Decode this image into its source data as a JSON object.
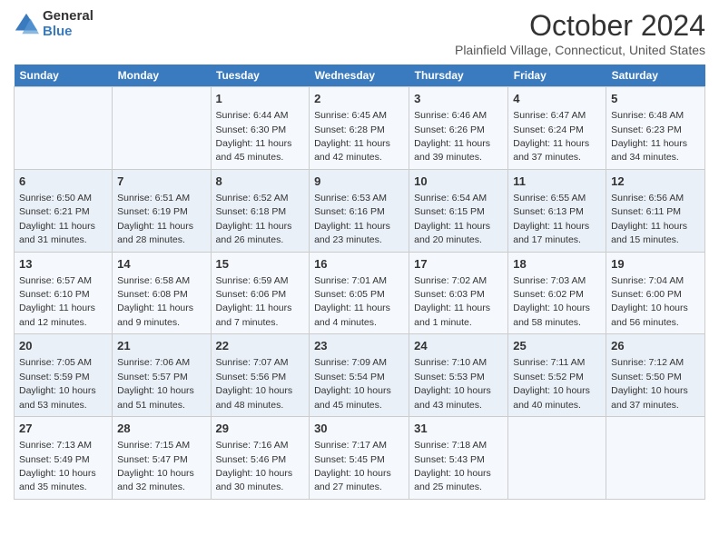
{
  "logo": {
    "general": "General",
    "blue": "Blue"
  },
  "header": {
    "month": "October 2024",
    "location": "Plainfield Village, Connecticut, United States"
  },
  "days_of_week": [
    "Sunday",
    "Monday",
    "Tuesday",
    "Wednesday",
    "Thursday",
    "Friday",
    "Saturday"
  ],
  "weeks": [
    [
      {
        "day": "",
        "info": ""
      },
      {
        "day": "",
        "info": ""
      },
      {
        "day": "1",
        "info": "Sunrise: 6:44 AM\nSunset: 6:30 PM\nDaylight: 11 hours and 45 minutes."
      },
      {
        "day": "2",
        "info": "Sunrise: 6:45 AM\nSunset: 6:28 PM\nDaylight: 11 hours and 42 minutes."
      },
      {
        "day": "3",
        "info": "Sunrise: 6:46 AM\nSunset: 6:26 PM\nDaylight: 11 hours and 39 minutes."
      },
      {
        "day": "4",
        "info": "Sunrise: 6:47 AM\nSunset: 6:24 PM\nDaylight: 11 hours and 37 minutes."
      },
      {
        "day": "5",
        "info": "Sunrise: 6:48 AM\nSunset: 6:23 PM\nDaylight: 11 hours and 34 minutes."
      }
    ],
    [
      {
        "day": "6",
        "info": "Sunrise: 6:50 AM\nSunset: 6:21 PM\nDaylight: 11 hours and 31 minutes."
      },
      {
        "day": "7",
        "info": "Sunrise: 6:51 AM\nSunset: 6:19 PM\nDaylight: 11 hours and 28 minutes."
      },
      {
        "day": "8",
        "info": "Sunrise: 6:52 AM\nSunset: 6:18 PM\nDaylight: 11 hours and 26 minutes."
      },
      {
        "day": "9",
        "info": "Sunrise: 6:53 AM\nSunset: 6:16 PM\nDaylight: 11 hours and 23 minutes."
      },
      {
        "day": "10",
        "info": "Sunrise: 6:54 AM\nSunset: 6:15 PM\nDaylight: 11 hours and 20 minutes."
      },
      {
        "day": "11",
        "info": "Sunrise: 6:55 AM\nSunset: 6:13 PM\nDaylight: 11 hours and 17 minutes."
      },
      {
        "day": "12",
        "info": "Sunrise: 6:56 AM\nSunset: 6:11 PM\nDaylight: 11 hours and 15 minutes."
      }
    ],
    [
      {
        "day": "13",
        "info": "Sunrise: 6:57 AM\nSunset: 6:10 PM\nDaylight: 11 hours and 12 minutes."
      },
      {
        "day": "14",
        "info": "Sunrise: 6:58 AM\nSunset: 6:08 PM\nDaylight: 11 hours and 9 minutes."
      },
      {
        "day": "15",
        "info": "Sunrise: 6:59 AM\nSunset: 6:06 PM\nDaylight: 11 hours and 7 minutes."
      },
      {
        "day": "16",
        "info": "Sunrise: 7:01 AM\nSunset: 6:05 PM\nDaylight: 11 hours and 4 minutes."
      },
      {
        "day": "17",
        "info": "Sunrise: 7:02 AM\nSunset: 6:03 PM\nDaylight: 11 hours and 1 minute."
      },
      {
        "day": "18",
        "info": "Sunrise: 7:03 AM\nSunset: 6:02 PM\nDaylight: 10 hours and 58 minutes."
      },
      {
        "day": "19",
        "info": "Sunrise: 7:04 AM\nSunset: 6:00 PM\nDaylight: 10 hours and 56 minutes."
      }
    ],
    [
      {
        "day": "20",
        "info": "Sunrise: 7:05 AM\nSunset: 5:59 PM\nDaylight: 10 hours and 53 minutes."
      },
      {
        "day": "21",
        "info": "Sunrise: 7:06 AM\nSunset: 5:57 PM\nDaylight: 10 hours and 51 minutes."
      },
      {
        "day": "22",
        "info": "Sunrise: 7:07 AM\nSunset: 5:56 PM\nDaylight: 10 hours and 48 minutes."
      },
      {
        "day": "23",
        "info": "Sunrise: 7:09 AM\nSunset: 5:54 PM\nDaylight: 10 hours and 45 minutes."
      },
      {
        "day": "24",
        "info": "Sunrise: 7:10 AM\nSunset: 5:53 PM\nDaylight: 10 hours and 43 minutes."
      },
      {
        "day": "25",
        "info": "Sunrise: 7:11 AM\nSunset: 5:52 PM\nDaylight: 10 hours and 40 minutes."
      },
      {
        "day": "26",
        "info": "Sunrise: 7:12 AM\nSunset: 5:50 PM\nDaylight: 10 hours and 37 minutes."
      }
    ],
    [
      {
        "day": "27",
        "info": "Sunrise: 7:13 AM\nSunset: 5:49 PM\nDaylight: 10 hours and 35 minutes."
      },
      {
        "day": "28",
        "info": "Sunrise: 7:15 AM\nSunset: 5:47 PM\nDaylight: 10 hours and 32 minutes."
      },
      {
        "day": "29",
        "info": "Sunrise: 7:16 AM\nSunset: 5:46 PM\nDaylight: 10 hours and 30 minutes."
      },
      {
        "day": "30",
        "info": "Sunrise: 7:17 AM\nSunset: 5:45 PM\nDaylight: 10 hours and 27 minutes."
      },
      {
        "day": "31",
        "info": "Sunrise: 7:18 AM\nSunset: 5:43 PM\nDaylight: 10 hours and 25 minutes."
      },
      {
        "day": "",
        "info": ""
      },
      {
        "day": "",
        "info": ""
      }
    ]
  ]
}
